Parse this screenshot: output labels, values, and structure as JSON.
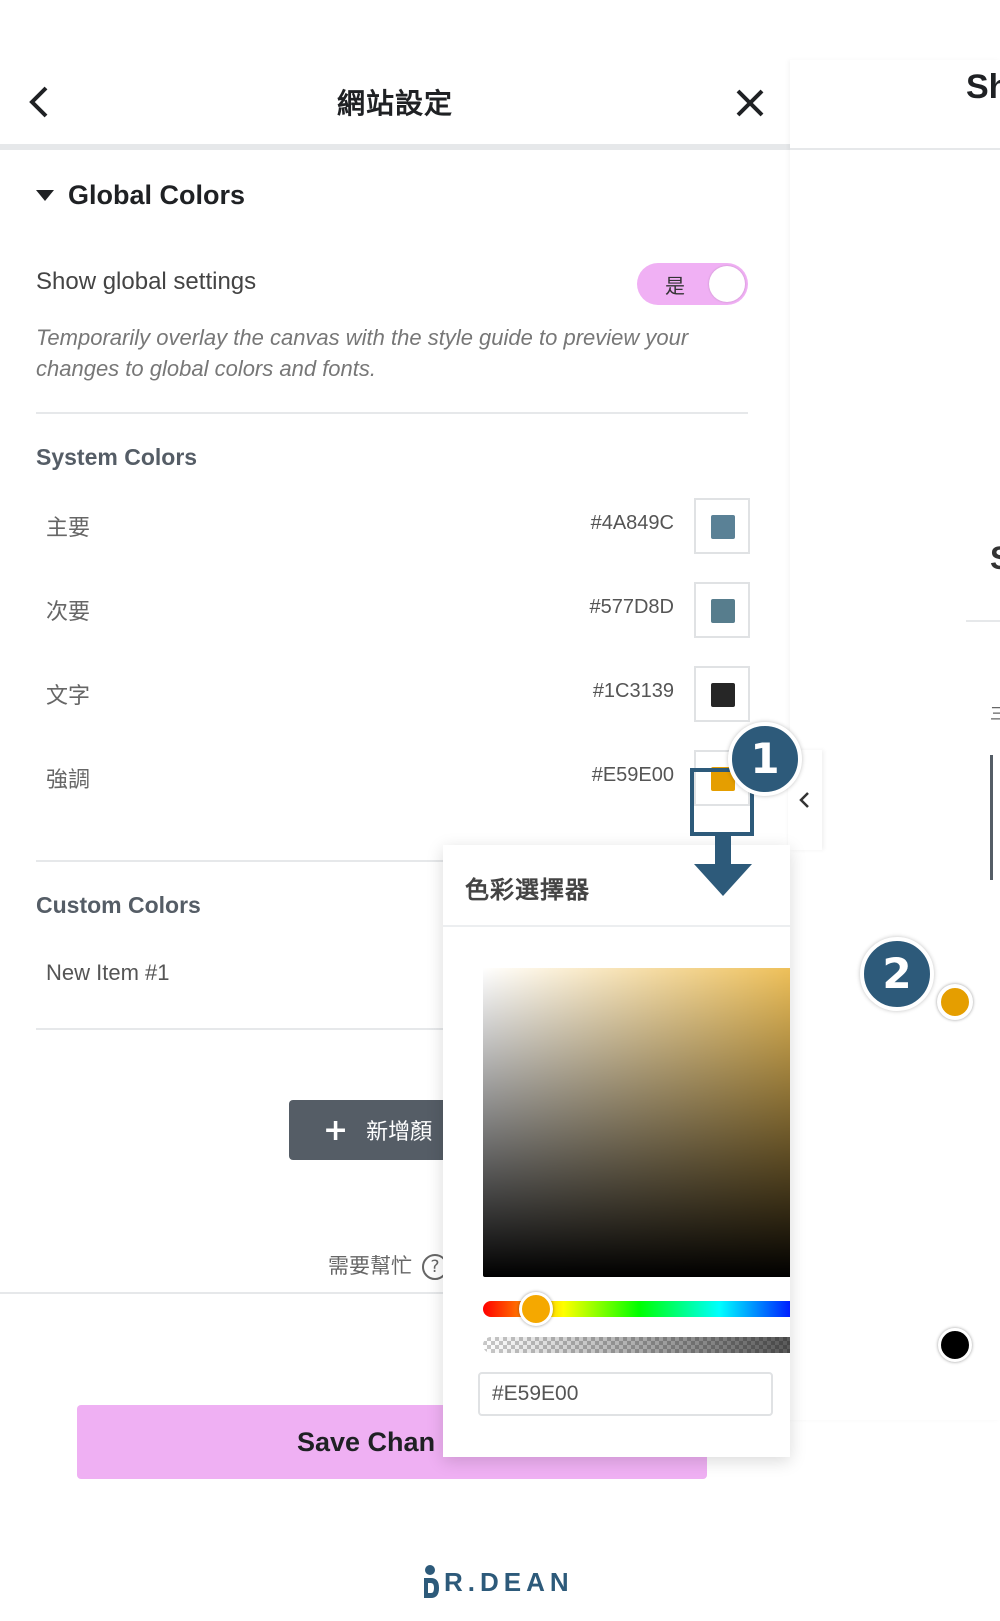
{
  "header": {
    "title": "網站設定"
  },
  "global_colors": {
    "section_title": "Global Colors",
    "show_label": "Show global settings",
    "toggle_value": "是",
    "hint": "Temporarily overlay the canvas with the style guide to preview your changes to global colors and fonts."
  },
  "system_colors": {
    "title": "System Colors",
    "items": [
      {
        "name": "主要",
        "hex": "#4A849C",
        "color": "#5a8196"
      },
      {
        "name": "次要",
        "hex": "#577D8D",
        "color": "#577d8d"
      },
      {
        "name": "文字",
        "hex": "#1C3139",
        "color": "#262626"
      },
      {
        "name": "強調",
        "hex": "#E59E00",
        "color": "#e59e00"
      }
    ]
  },
  "custom_colors": {
    "title": "Custom Colors",
    "items": [
      {
        "name": "New Item #1"
      }
    ]
  },
  "add_color_label": "新增顏",
  "help_label": "需要幫忙",
  "help_icon": "?",
  "save_label": "Save Chan",
  "right_panel": {
    "title": "Sh",
    "partial_letter": "S",
    "tiny": "三"
  },
  "picker": {
    "title": "色彩選擇器",
    "hex_value": "#E59E00",
    "hue_fraction": 0.11,
    "alpha": 1.0,
    "tools": [
      "reset-icon",
      "global-colors-icon",
      "eyedropper-icon"
    ]
  },
  "annotations": {
    "badge_1": "1",
    "badge_2": "2"
  },
  "logo": {
    "text": "R.DEAN"
  },
  "colors": {
    "accent_pink": "#efb0f3",
    "annotation_blue": "#2d5a7a",
    "button_gray": "#555d66"
  }
}
